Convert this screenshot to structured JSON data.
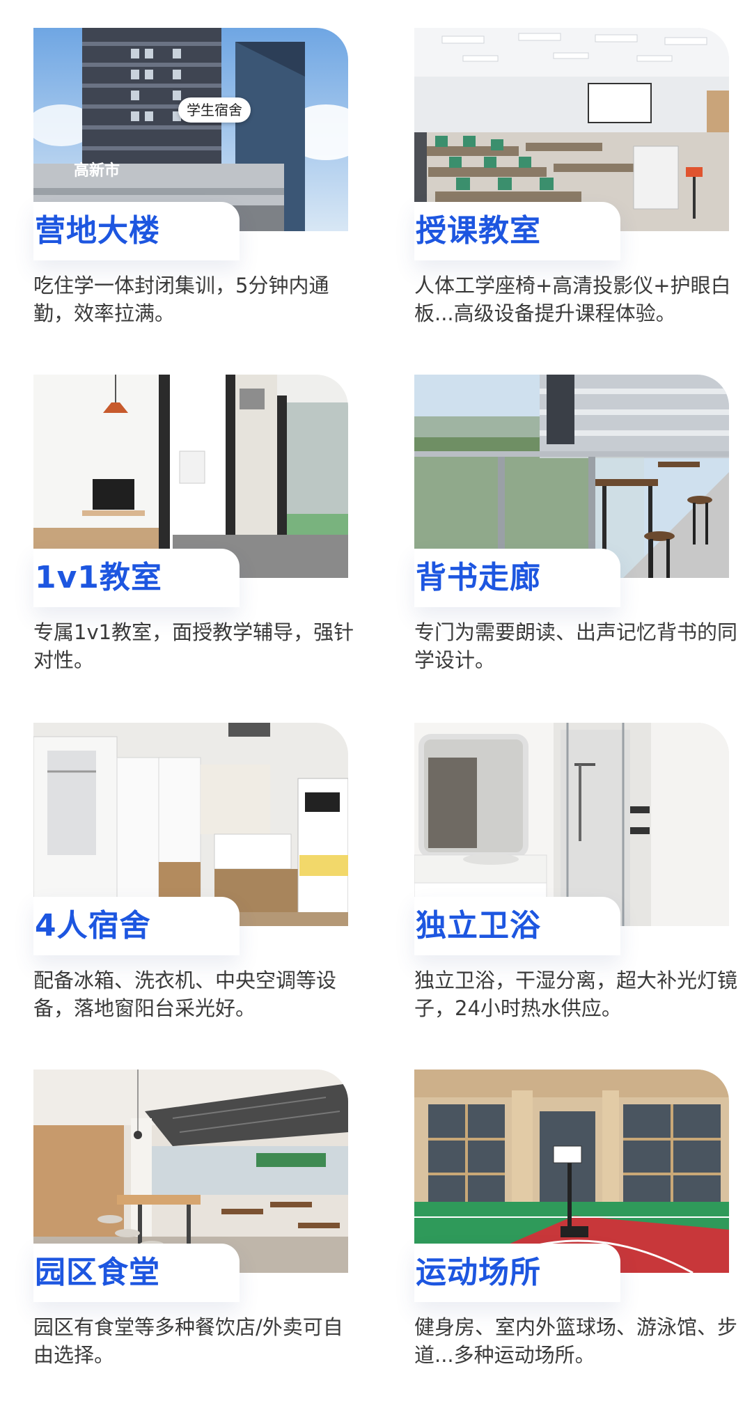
{
  "cards": [
    {
      "title": "营地大楼",
      "desc": "吃住学一体封闭集训，5分钟内通勤，效率拉满。",
      "photo_label": "学生宿舍",
      "photo_icon": "building-photo"
    },
    {
      "title": "授课教室",
      "desc": "人体工学座椅+高清投影仪+护眼白板...高级设备提升课程体验。",
      "photo_icon": "classroom-photo"
    },
    {
      "title": "1v1教室",
      "desc": "专属1v1教室，面授教学辅导，强针对性。",
      "photo_icon": "private-room-photo"
    },
    {
      "title": "背书走廊",
      "desc": "专门为需要朗读、出声记忆背书的同学设计。",
      "photo_icon": "corridor-photo"
    },
    {
      "title": "4人宿舍",
      "desc": "配备冰箱、洗衣机、中央空调等设备，落地窗阳台采光好。",
      "photo_icon": "dorm-photo"
    },
    {
      "title": "独立卫浴",
      "desc": "独立卫浴，干湿分离，超大补光灯镜子，24小时热水供应。",
      "photo_icon": "bathroom-photo"
    },
    {
      "title": "园区食堂",
      "desc": "园区有食堂等多种餐饮店/外卖可自由选择。",
      "photo_icon": "canteen-photo"
    },
    {
      "title": "运动场所",
      "desc": "健身房、室内外篮球场、游泳馆、步道...多种运动场所。",
      "photo_icon": "sports-hall-photo"
    }
  ],
  "colors": {
    "title": "#1d56e0",
    "text": "#3a3a3a"
  }
}
